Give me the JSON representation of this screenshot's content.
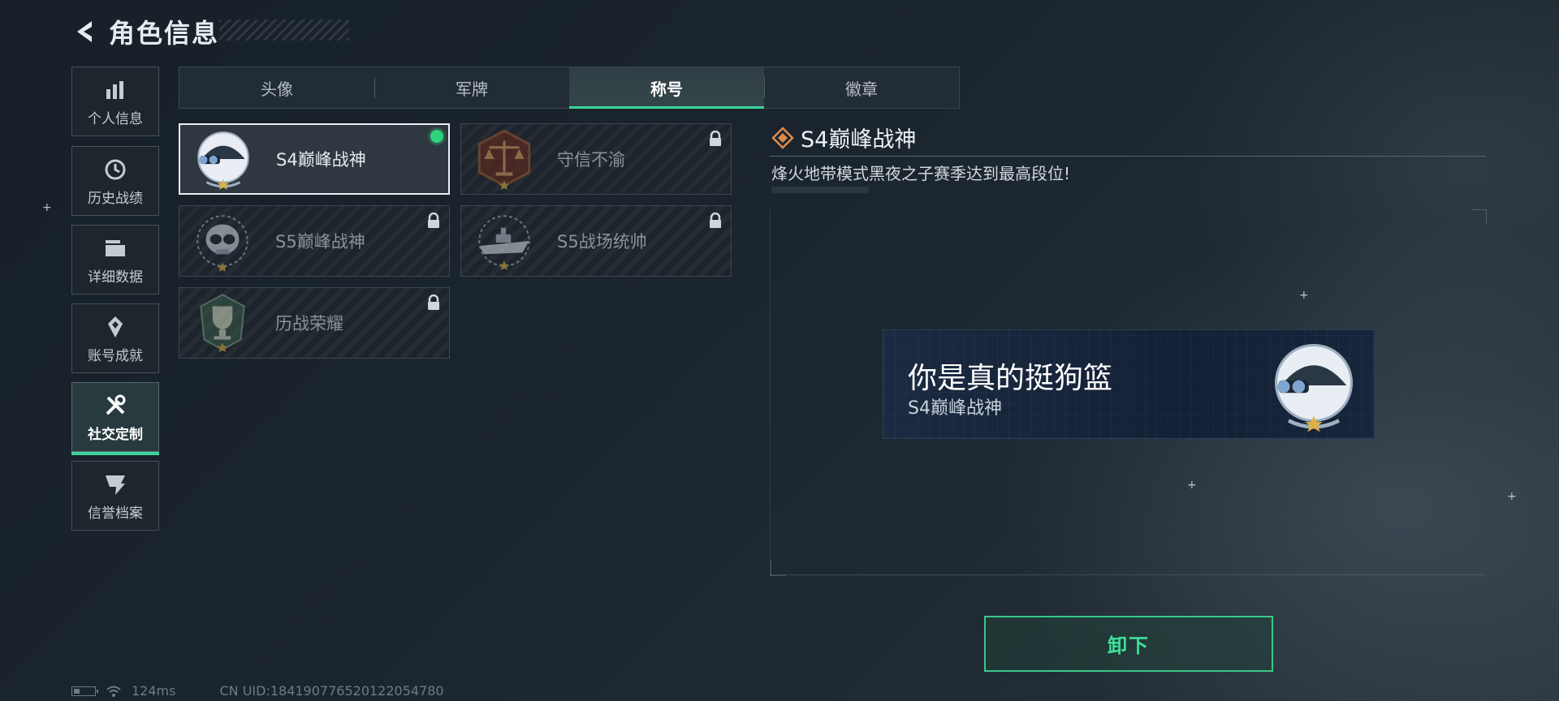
{
  "header": {
    "title": "角色信息"
  },
  "sidebar": {
    "items": [
      {
        "label": "个人信息",
        "icon": "bar-chart-icon",
        "active": false
      },
      {
        "label": "历史战绩",
        "icon": "history-icon",
        "active": false
      },
      {
        "label": "详细数据",
        "icon": "folder-icon",
        "active": false
      },
      {
        "label": "账号成就",
        "icon": "achievement-icon",
        "active": false
      },
      {
        "label": "社交定制",
        "icon": "tools-icon",
        "active": true
      },
      {
        "label": "信誉档案",
        "icon": "credit-icon",
        "active": false
      }
    ]
  },
  "tabs": [
    {
      "label": "头像",
      "active": false
    },
    {
      "label": "军牌",
      "active": false
    },
    {
      "label": "称号",
      "active": true
    },
    {
      "label": "徽章",
      "active": false
    }
  ],
  "titles": [
    {
      "name": "S4巅峰战神",
      "emblem": "helmet-emblem",
      "selected": true,
      "equipped": true,
      "locked": false
    },
    {
      "name": "守信不渝",
      "emblem": "scales-emblem",
      "selected": false,
      "equipped": false,
      "locked": true
    },
    {
      "name": "S5巅峰战神",
      "emblem": "skull-emblem",
      "selected": false,
      "equipped": false,
      "locked": true
    },
    {
      "name": "S5战场统帅",
      "emblem": "warship-emblem",
      "selected": false,
      "equipped": false,
      "locked": true
    },
    {
      "name": "历战荣耀",
      "emblem": "trophy-emblem",
      "selected": false,
      "equipped": false,
      "locked": true
    }
  ],
  "detail": {
    "title": "S4巅峰战神",
    "description": "烽火地带模式黑夜之子赛季达到最高段位!"
  },
  "preview": {
    "player_name": "你是真的挺狗篮",
    "title": "S4巅峰战神"
  },
  "actions": {
    "unequip_label": "卸下"
  },
  "status": {
    "ping": "124ms",
    "uid": "CN UID:184190776520122054780"
  },
  "colors": {
    "accent": "#3ed39a",
    "equipped_dot": "#2fd27a",
    "title_icon": "#e08a4a"
  }
}
